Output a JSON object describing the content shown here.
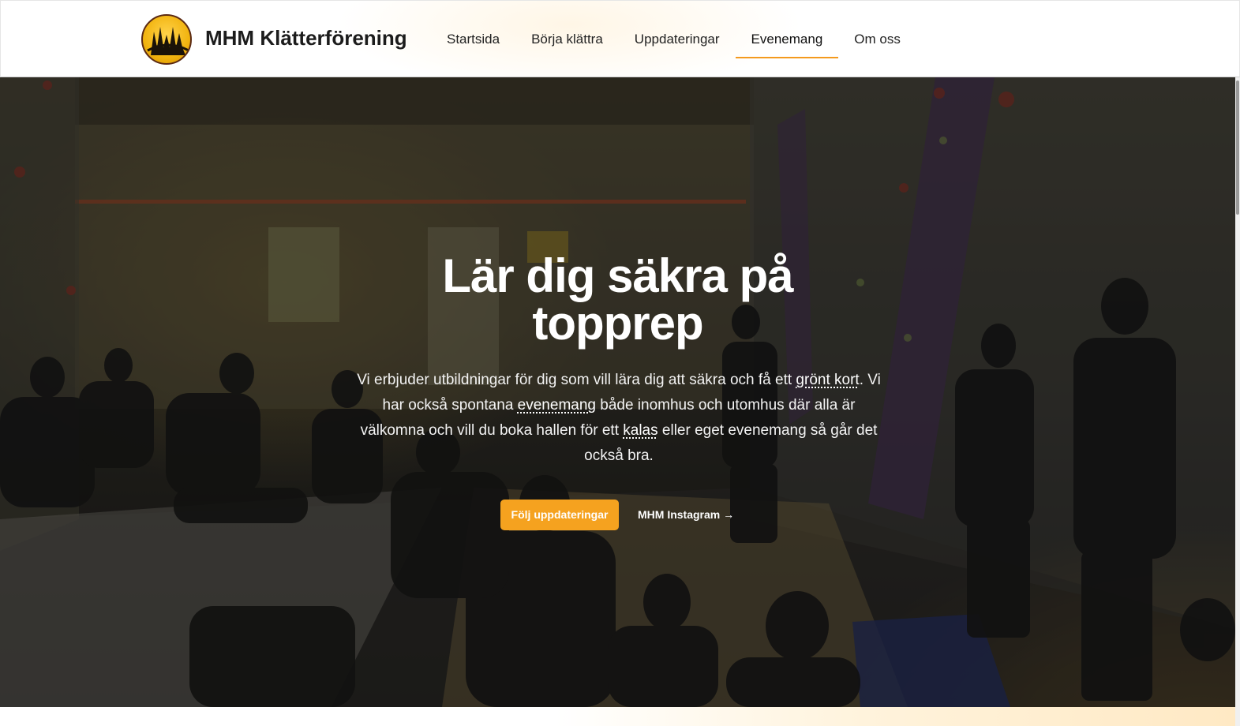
{
  "brand": {
    "name": "MHM Klätterförening",
    "logo_icon": "mhm-logo-icon"
  },
  "nav": {
    "items": [
      {
        "label": "Startsida",
        "active": false
      },
      {
        "label": "Börja klättra",
        "active": false
      },
      {
        "label": "Uppdateringar",
        "active": false
      },
      {
        "label": "Evenemang",
        "active": true
      },
      {
        "label": "Om oss",
        "active": false
      }
    ]
  },
  "hero": {
    "title_line1": "Lär dig säkra på",
    "title_line2": "topprep",
    "text": {
      "part1": "Vi erbjuder utbildningar för dig som vill lära dig att säkra och få ett ",
      "link1": "grönt kort",
      "part2": ". Vi har också spontana ",
      "link2": "evenemang",
      "part3": " både inomhus och utomhus där alla är välkomna och vill du boka hallen för ett ",
      "link3": "kalas",
      "part4": " eller eget evenemang så går det också bra."
    },
    "primary_button": "Följ uppdateringar",
    "secondary_link": "MHM Instagram →"
  },
  "colors": {
    "accent": "#f5a21f",
    "active_underline": "#f49a1e",
    "text_dark": "#1c1c1c"
  }
}
